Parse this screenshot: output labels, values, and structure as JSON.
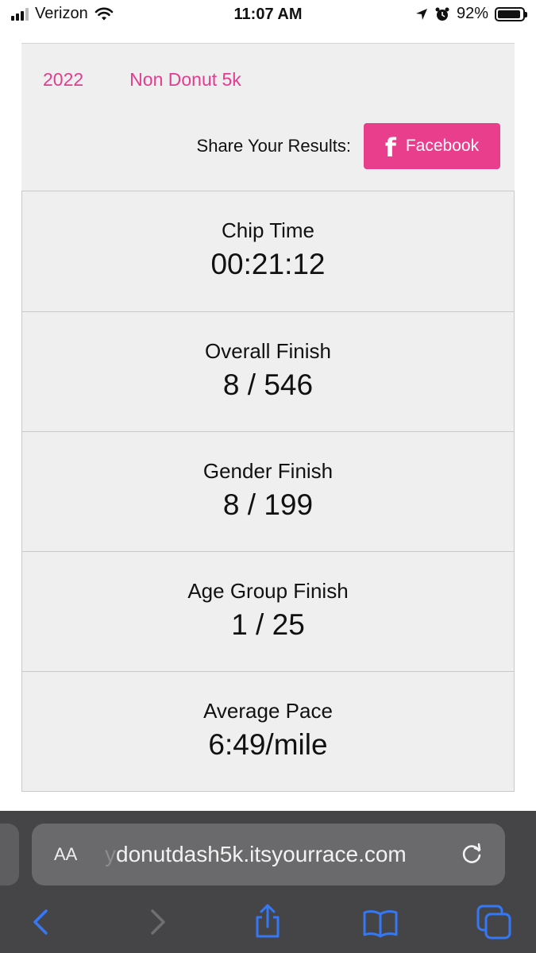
{
  "status_bar": {
    "carrier": "Verizon",
    "time": "11:07 AM",
    "battery": "92%",
    "battery_level": 0.92
  },
  "header": {
    "year": "2022",
    "race_name": "Non Donut 5k",
    "share_label": "Share Your Results:",
    "facebook_icon": "f",
    "facebook_label": "Facebook"
  },
  "results": [
    {
      "label": "Chip Time",
      "value": "00:21:12"
    },
    {
      "label": "Overall Finish",
      "value": "8 / 546"
    },
    {
      "label": "Gender Finish",
      "value": "8 / 199"
    },
    {
      "label": "Age Group Finish",
      "value": "1 / 25"
    },
    {
      "label": "Average Pace",
      "value": "6:49/mile"
    }
  ],
  "browser": {
    "text_size_label": "AA",
    "url_fade": "y",
    "url": "donutdash5k.itsyourrace.com",
    "icons": [
      "back-icon",
      "forward-icon",
      "share-icon",
      "bookmarks-icon",
      "tabs-icon",
      "reload-icon"
    ]
  },
  "colors": {
    "accent": "#e23d8f",
    "facebook_button": "#e83e8c",
    "panel_background": "#efefef",
    "safari_toolbar": "#454547",
    "toolbar_icon": "#3478f6"
  }
}
